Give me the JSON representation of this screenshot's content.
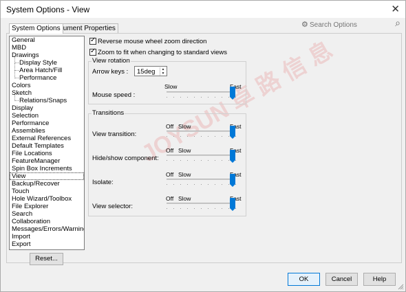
{
  "window": {
    "title": "System Options - View",
    "close_glyph": "✕"
  },
  "tabs": [
    {
      "label": "System Options",
      "active": true
    },
    {
      "label": "Document Properties",
      "active": false
    }
  ],
  "search": {
    "placeholder": "Search Options",
    "icon": "gear-icon"
  },
  "tree": [
    {
      "label": "General",
      "child": false
    },
    {
      "label": "MBD",
      "child": false
    },
    {
      "label": "Drawings",
      "child": false
    },
    {
      "label": "Display Style",
      "child": true
    },
    {
      "label": "Area Hatch/Fill",
      "child": true
    },
    {
      "label": "Performance",
      "child": true
    },
    {
      "label": "Colors",
      "child": false
    },
    {
      "label": "Sketch",
      "child": false
    },
    {
      "label": "Relations/Snaps",
      "child": true
    },
    {
      "label": "Display",
      "child": false
    },
    {
      "label": "Selection",
      "child": false
    },
    {
      "label": "Performance",
      "child": false
    },
    {
      "label": "Assemblies",
      "child": false
    },
    {
      "label": "External References",
      "child": false
    },
    {
      "label": "Default Templates",
      "child": false
    },
    {
      "label": "File Locations",
      "child": false
    },
    {
      "label": "FeatureManager",
      "child": false
    },
    {
      "label": "Spin Box Increments",
      "child": false
    },
    {
      "label": "View",
      "child": false,
      "selected": true
    },
    {
      "label": "Backup/Recover",
      "child": false
    },
    {
      "label": "Touch",
      "child": false
    },
    {
      "label": "Hole Wizard/Toolbox",
      "child": false
    },
    {
      "label": "File Explorer",
      "child": false
    },
    {
      "label": "Search",
      "child": false
    },
    {
      "label": "Collaboration",
      "child": false
    },
    {
      "label": "Messages/Errors/Warnings",
      "child": false
    },
    {
      "label": "Import",
      "child": false
    },
    {
      "label": "Export",
      "child": false
    }
  ],
  "reset_label": "Reset...",
  "options": {
    "reverse_wheel": {
      "label": "Reverse mouse wheel zoom direction",
      "checked": true
    },
    "zoom_to_fit": {
      "label": "Zoom to fit when changing to standard views",
      "checked": true
    }
  },
  "view_rotation": {
    "title": "View rotation",
    "arrow_keys_label": "Arrow keys :",
    "arrow_keys_value": "15deg",
    "slow_label": "Slow",
    "fast_label": "Fast",
    "mouse_speed_label": "Mouse speed :",
    "mouse_speed_level": 1.0
  },
  "transitions": {
    "title": "Transitions",
    "off_label": "Off",
    "slow_label": "Slow",
    "fast_label": "Fast",
    "rows": [
      {
        "label": "View transition:",
        "level": 1.0
      },
      {
        "label": "Hide/show component:",
        "level": 1.0
      },
      {
        "label": "Isolate:",
        "level": 1.0
      },
      {
        "label": "View selector:",
        "level": 1.0
      }
    ]
  },
  "buttons": {
    "ok": "OK",
    "cancel": "Cancel",
    "help": "Help"
  },
  "colors": {
    "accent": "#0078d7"
  }
}
